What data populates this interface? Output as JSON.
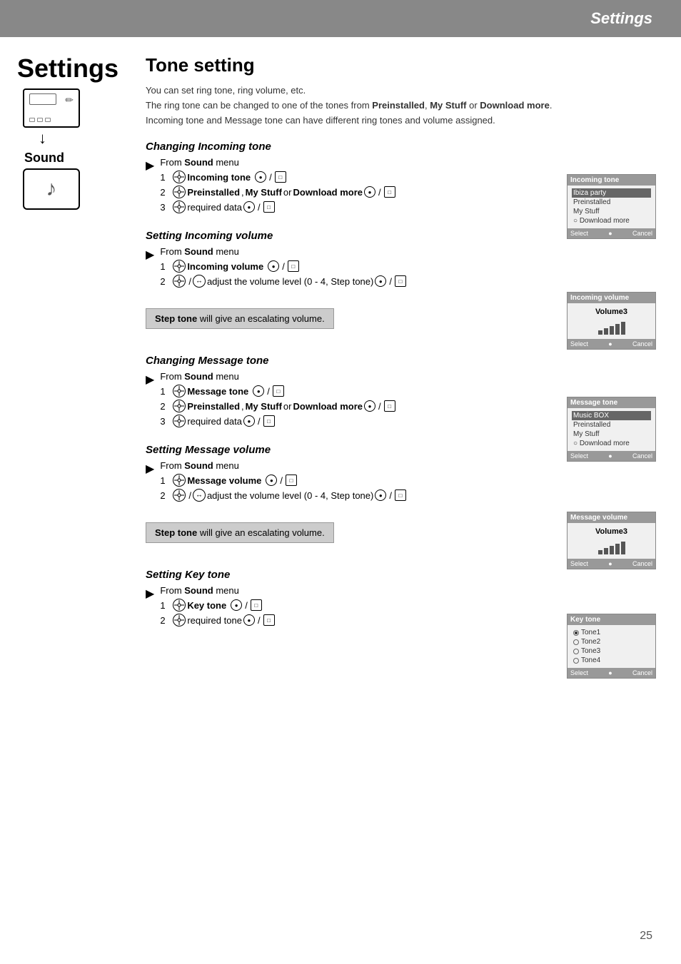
{
  "header": {
    "title": "Settings"
  },
  "sidebar": {
    "title": "Settings",
    "sound_label": "Sound"
  },
  "article": {
    "title": "Tone  setting",
    "intro": [
      "You can set ring tone, ring volume, etc.",
      "The ring tone can be changed to one of the tones from Preinstalled, My Stuff or Download more. Incoming tone and Message tone can have different ring tones and volume assigned."
    ],
    "sections": [
      {
        "id": "changing-incoming-tone",
        "heading": "Changing Incoming tone",
        "from_sound": "From Sound menu",
        "steps": [
          {
            "num": "1",
            "text": "Incoming tone"
          },
          {
            "num": "2",
            "text": "Preinstalled, My Stuff or Download more"
          },
          {
            "num": "3",
            "text": "required data"
          }
        ]
      },
      {
        "id": "setting-incoming-volume",
        "heading": "Setting Incoming volume",
        "from_sound": "From Sound menu",
        "steps": [
          {
            "num": "1",
            "text": "Incoming volume"
          },
          {
            "num": "2",
            "text": "/ adjust the volume level (0 - 4, Step tone)"
          }
        ],
        "note": "Step tone will give an escalating volume."
      },
      {
        "id": "changing-message-tone",
        "heading": "Changing Message tone",
        "from_sound": "From Sound menu",
        "steps": [
          {
            "num": "1",
            "text": "Message tone"
          },
          {
            "num": "2",
            "text": "Preinstalled, My Stuff or Download more"
          },
          {
            "num": "3",
            "text": "required data"
          }
        ]
      },
      {
        "id": "setting-message-volume",
        "heading": "Setting Message volume",
        "from_sound": "From Sound menu",
        "steps": [
          {
            "num": "1",
            "text": "Message volume"
          },
          {
            "num": "2",
            "text": "/ adjust the volume level (0 - 4, Step tone)"
          }
        ],
        "note": "Step tone will give an escalating volume."
      },
      {
        "id": "setting-key-tone",
        "heading": "Setting Key tone",
        "from_sound": "From Sound menu",
        "steps": [
          {
            "num": "1",
            "text": "Key tone"
          },
          {
            "num": "2",
            "text": "required tone"
          }
        ]
      }
    ]
  },
  "screens": [
    {
      "id": "incoming-tone-screen",
      "title": "Incoming tone",
      "items": [
        "Ibiza party",
        "Preinstalled",
        "My Stuff",
        "○ Download more"
      ],
      "highlighted": 0,
      "bottom": "Select  ●  Cancel"
    },
    {
      "id": "incoming-volume-screen",
      "title": "Incoming volume",
      "volume_label": "Volume3",
      "bars": [
        1,
        2,
        3,
        4,
        5
      ],
      "bottom": "Select  ●  Cancel"
    },
    {
      "id": "message-tone-screen",
      "title": "Message tone",
      "items": [
        "Music BOX",
        "Preinstalled",
        "My Stuff",
        "○ Download more"
      ],
      "highlighted": 0,
      "bottom": "Select  ●  Cancel"
    },
    {
      "id": "message-volume-screen",
      "title": "Message volume",
      "volume_label": "Volume3",
      "bars": [
        1,
        2,
        3,
        4,
        5
      ],
      "bottom": "Select  ●  Cancel"
    },
    {
      "id": "key-tone-screen",
      "title": "Key tone",
      "radio_items": [
        "Tone1",
        "Tone2",
        "Tone3",
        "Tone4"
      ],
      "selected_index": 0,
      "bottom": "Select  ●  Cancel"
    }
  ],
  "page_number": "25"
}
